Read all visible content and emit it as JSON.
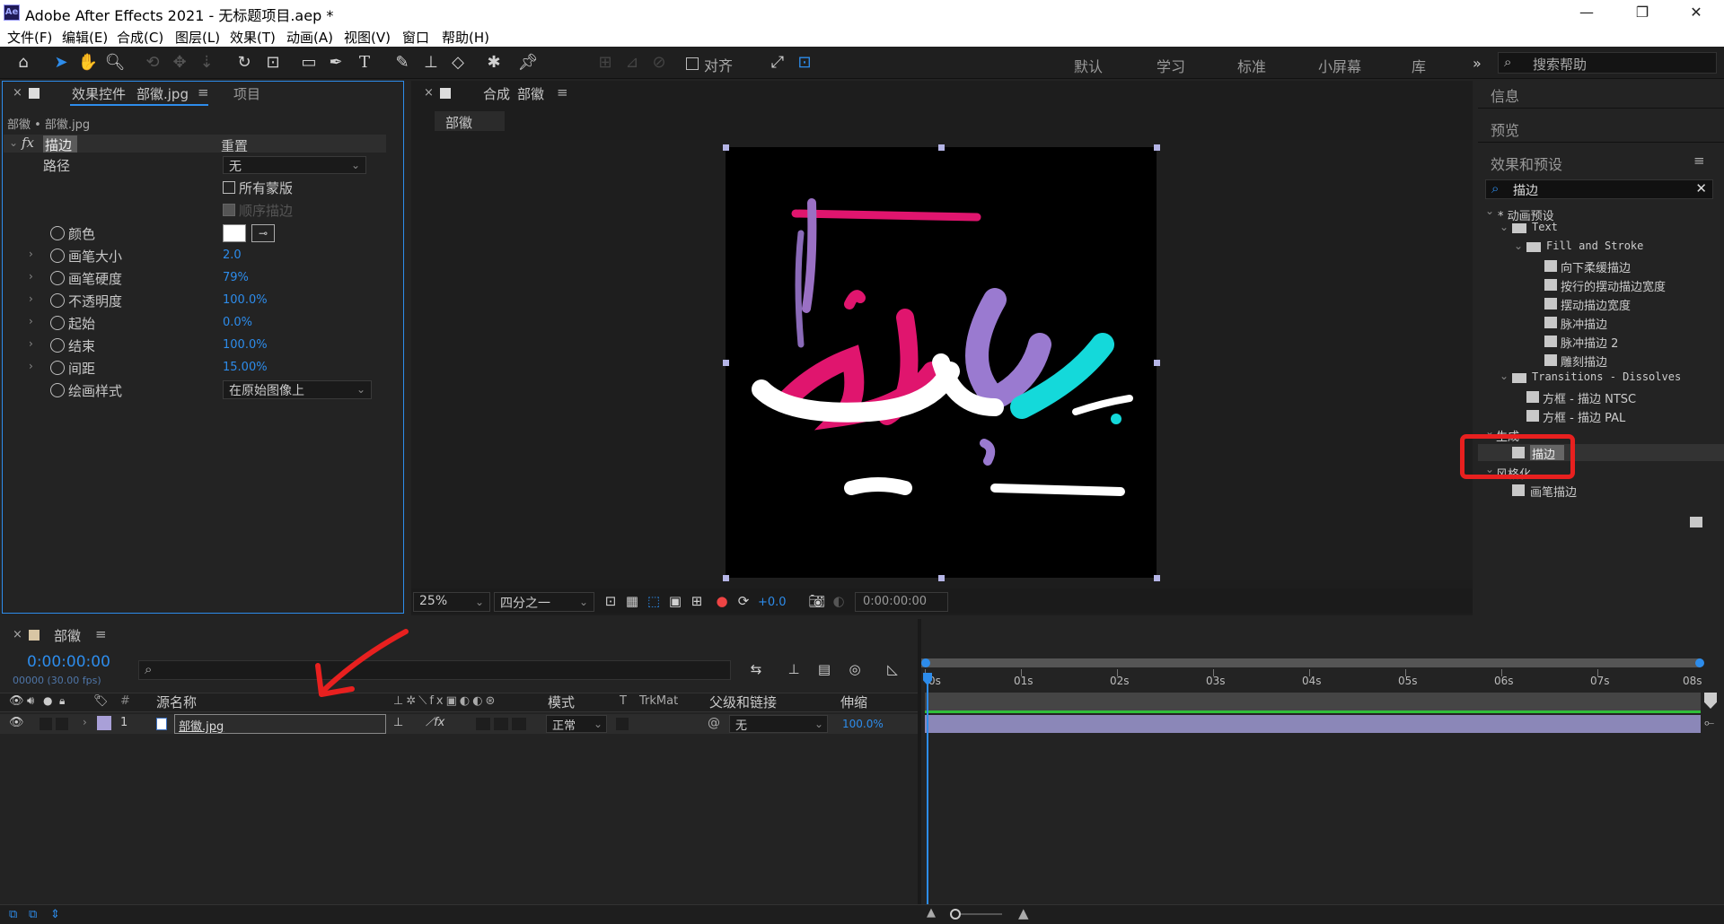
{
  "app": {
    "title": "Adobe After Effects 2021 - 无标题项目.aep *",
    "icon_label": "Ae"
  },
  "window_controls": {
    "minimize": "—",
    "maximize": "❐",
    "close": "✕"
  },
  "menu": [
    "文件(F)",
    "编辑(E)",
    "合成(C)",
    "图层(L)",
    "效果(T)",
    "动画(A)",
    "视图(V)",
    "窗口",
    "帮助(H)"
  ],
  "toolbar": {
    "align_label": "对齐",
    "workspaces": [
      "默认",
      "学习",
      "标准",
      "小屏幕",
      "库"
    ],
    "more": "»",
    "search_help_placeholder": "搜索帮助"
  },
  "effect_controls": {
    "tab_label": "效果控件",
    "tab_file": "部徽.jpg",
    "project_tab": "项目",
    "breadcrumb": "部徽 • 部徽.jpg",
    "fx_label": "fx",
    "effect_name": "描边",
    "reset": "重置",
    "path_label": "路径",
    "path_value": "无",
    "all_masks": "所有蒙版",
    "sequential": "顺序描边",
    "props": [
      {
        "name": "颜色",
        "value": ""
      },
      {
        "name": "画笔大小",
        "value": "2.0"
      },
      {
        "name": "画笔硬度",
        "value": "79%"
      },
      {
        "name": "不透明度",
        "value": "100.0%"
      },
      {
        "name": "起始",
        "value": "0.0%"
      },
      {
        "name": "结束",
        "value": "100.0%"
      },
      {
        "name": "间距",
        "value": "15.00%"
      },
      {
        "name": "绘画样式",
        "value": "在原始图像上"
      }
    ]
  },
  "composition": {
    "tab_label": "合成",
    "tab_name": "部徽",
    "subtab": "部徽",
    "zoom": "25%",
    "resolution": "四分之一",
    "exposure": "+0.0",
    "timecode": "0:00:00:00"
  },
  "right_panel": {
    "info": "信息",
    "preview": "预览",
    "effects_presets": "效果和预设",
    "search_value": "描边",
    "tree": [
      {
        "label": "* 动画预设",
        "level": 0,
        "kind": "folder-open"
      },
      {
        "label": "Text",
        "level": 1,
        "kind": "folder"
      },
      {
        "label": "Fill and Stroke",
        "level": 2,
        "kind": "folder"
      },
      {
        "label": "向下柔缓描边",
        "level": 3,
        "kind": "preset"
      },
      {
        "label": "按行的摆动描边宽度",
        "level": 3,
        "kind": "preset"
      },
      {
        "label": "摆动描边宽度",
        "level": 3,
        "kind": "preset"
      },
      {
        "label": "脉冲描边",
        "level": 3,
        "kind": "preset"
      },
      {
        "label": "脉冲描边 2",
        "level": 3,
        "kind": "preset"
      },
      {
        "label": "雕刻描边",
        "level": 3,
        "kind": "preset"
      },
      {
        "label": "Transitions - Dissolves",
        "level": 1,
        "kind": "folder"
      },
      {
        "label": "方框 - 描边 NTSC",
        "level": 2,
        "kind": "preset"
      },
      {
        "label": "方框 - 描边 PAL",
        "level": 2,
        "kind": "preset"
      },
      {
        "label": "生成",
        "level": 0,
        "kind": "category"
      },
      {
        "label": "描边",
        "level": 1,
        "kind": "effect-selected"
      },
      {
        "label": "风格化",
        "level": 0,
        "kind": "category"
      },
      {
        "label": "画笔描边",
        "level": 1,
        "kind": "effect"
      }
    ]
  },
  "timeline": {
    "tab": "部徽",
    "timecode": "0:00:00:00",
    "frames_fps": "00000 (30.00 fps)",
    "col_hash": "#",
    "col_source": "源名称",
    "col_mode": "模式",
    "col_t": "T",
    "col_trkmat": "TrkMat",
    "col_parent": "父级和链接",
    "col_stretch": "伸缩",
    "layer": {
      "num": "1",
      "name": "部徽.jpg",
      "mode": "正常",
      "parent": "无",
      "stretch": "100.0%"
    },
    "ruler": [
      "0s",
      "01s",
      "02s",
      "03s",
      "04s",
      "05s",
      "06s",
      "07s",
      "08s"
    ]
  },
  "colors": {
    "accent": "#2d8ceb",
    "annotation": "#e8201f",
    "layer_label": "#a9a0d8"
  }
}
